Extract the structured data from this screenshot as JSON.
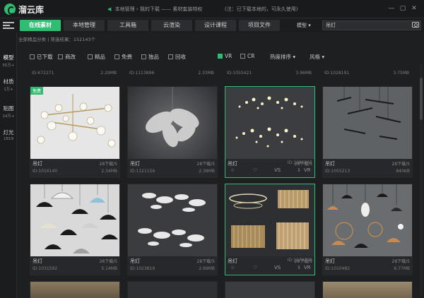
{
  "app": {
    "title": "溜云库"
  },
  "header": {
    "breadcrumb": [
      "本地管理",
      "我的下载",
      "素材套装特权"
    ],
    "notice": "(注：已下载本地的，可永久使用)"
  },
  "nav": {
    "tabs": [
      {
        "label": "在线素材",
        "active": true
      },
      {
        "label": "本地管理",
        "active": false
      },
      {
        "label": "工具箱",
        "active": false
      },
      {
        "label": "云渲染",
        "active": false
      },
      {
        "label": "设计课程",
        "active": false
      },
      {
        "label": "项目文件",
        "active": false
      }
    ],
    "model_select": "模型",
    "search_value": "吊灯"
  },
  "info": {
    "category": "全部精品分类",
    "count": "筛选结果：152143个"
  },
  "filters": {
    "checks": [
      {
        "label": "已下载",
        "on": false
      },
      {
        "label": "商改",
        "on": false
      },
      {
        "label": "精品",
        "on": false
      },
      {
        "label": "免费",
        "on": false
      },
      {
        "label": "独品",
        "on": false
      },
      {
        "label": "回收",
        "on": false
      },
      {
        "label": "VR",
        "on": true
      },
      {
        "label": "CR",
        "on": false
      }
    ],
    "sort": "热度排序",
    "style": "风格"
  },
  "sidebar": {
    "items": [
      {
        "label": "模型",
        "count": "55万+",
        "active": true
      },
      {
        "label": "材质",
        "count": "1万+",
        "active": false
      },
      {
        "label": "贴图",
        "count": "14万+",
        "active": false
      },
      {
        "label": "灯光",
        "count": "1819",
        "active": false
      }
    ]
  },
  "top_partial": [
    {
      "id": "ID:672271",
      "size": "2.29MB"
    },
    {
      "id": "ID:1113896",
      "size": "2.33MB"
    },
    {
      "id": "ID:1055421",
      "size": "3.96MB"
    },
    {
      "id": "ID:1028191",
      "size": "3.75MB"
    }
  ],
  "cards": [
    {
      "name": "吊灯",
      "downloads": "28下载/5",
      "id": "ID:1016140",
      "size": "2.34MB",
      "free": true,
      "selected": false,
      "actions": false
    },
    {
      "name": "吊灯",
      "downloads": "28下载/5",
      "id": "ID:1121156",
      "size": "2.38MB",
      "free": false,
      "selected": false,
      "actions": false
    },
    {
      "name": "吊灯",
      "downloads": "28下载/5",
      "id": "ID:1080965",
      "size": "",
      "free": false,
      "selected": true,
      "actions": true
    },
    {
      "name": "吊灯",
      "downloads": "28下载/5",
      "id": "ID:1055213",
      "size": "840KB",
      "free": false,
      "selected": false,
      "actions": false
    },
    {
      "name": "吊灯",
      "downloads": "28下载/5",
      "id": "ID:1031592",
      "size": "5.14MB",
      "free": false,
      "selected": false,
      "actions": false
    },
    {
      "name": "吊灯",
      "downloads": "28下载/5",
      "id": "ID:1023819",
      "size": "2.69MB",
      "free": false,
      "selected": false,
      "actions": false
    },
    {
      "name": "吊灯",
      "downloads": "28下载/5",
      "id": "ID:1079799",
      "size": "",
      "free": false,
      "selected": true,
      "actions": true
    },
    {
      "name": "吊灯",
      "downloads": "28下载/5",
      "id": "ID:1010482",
      "size": "6.77MB",
      "free": false,
      "selected": false,
      "actions": false
    }
  ],
  "card_actions": {
    "vs": "VS",
    "vr": "VR"
  },
  "tag_free": "免费",
  "colors": {
    "accent": "#2fbd72",
    "bg": "#1e1f21",
    "card": "#26282b"
  }
}
